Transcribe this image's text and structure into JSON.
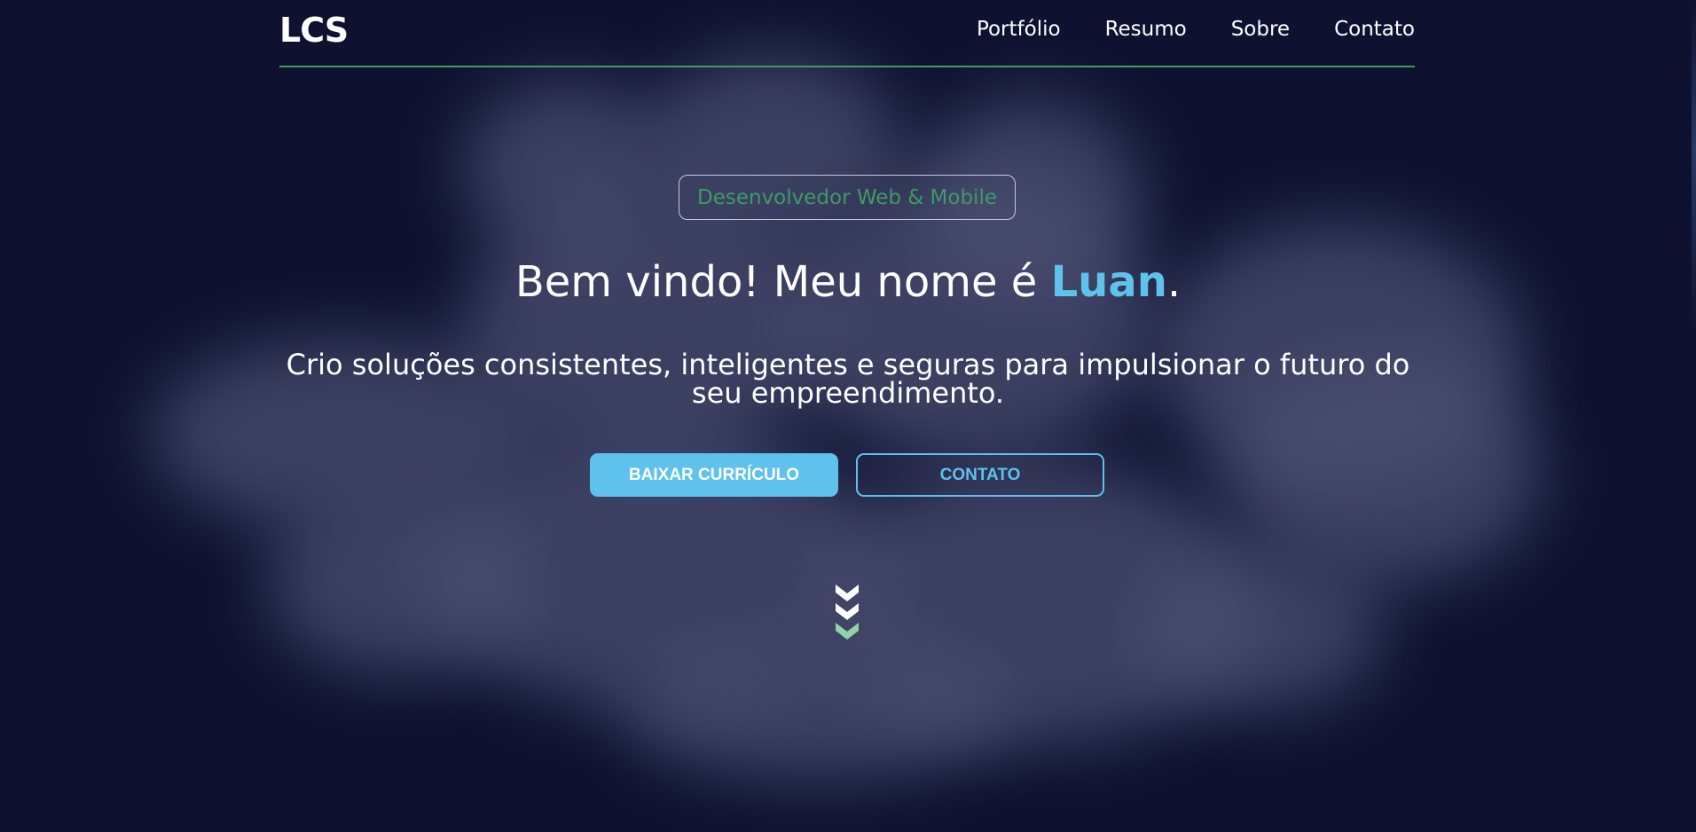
{
  "header": {
    "logo": "LCS",
    "nav": [
      {
        "label": "Portfólio"
      },
      {
        "label": "Resumo"
      },
      {
        "label": "Sobre"
      },
      {
        "label": "Contato"
      }
    ]
  },
  "hero": {
    "role_badge": "Desenvolvedor Web & Mobile",
    "headline_prefix": "Bem vindo! Meu nome é ",
    "headline_name": "Luan",
    "headline_suffix": ".",
    "subtitle": "Crio soluções consistentes, inteligentes e seguras para impulsionar o futuro do seu empreendimento.",
    "primary_button": "BAIXAR CURRÍCULO",
    "secondary_button": "CONTATO",
    "scroll_icon": "triple-chevron-down-icon"
  },
  "colors": {
    "background": "#0e1230",
    "accent_blue": "#5ec2ed",
    "accent_green": "#3e9b63",
    "smoke": "#4b4f72"
  }
}
